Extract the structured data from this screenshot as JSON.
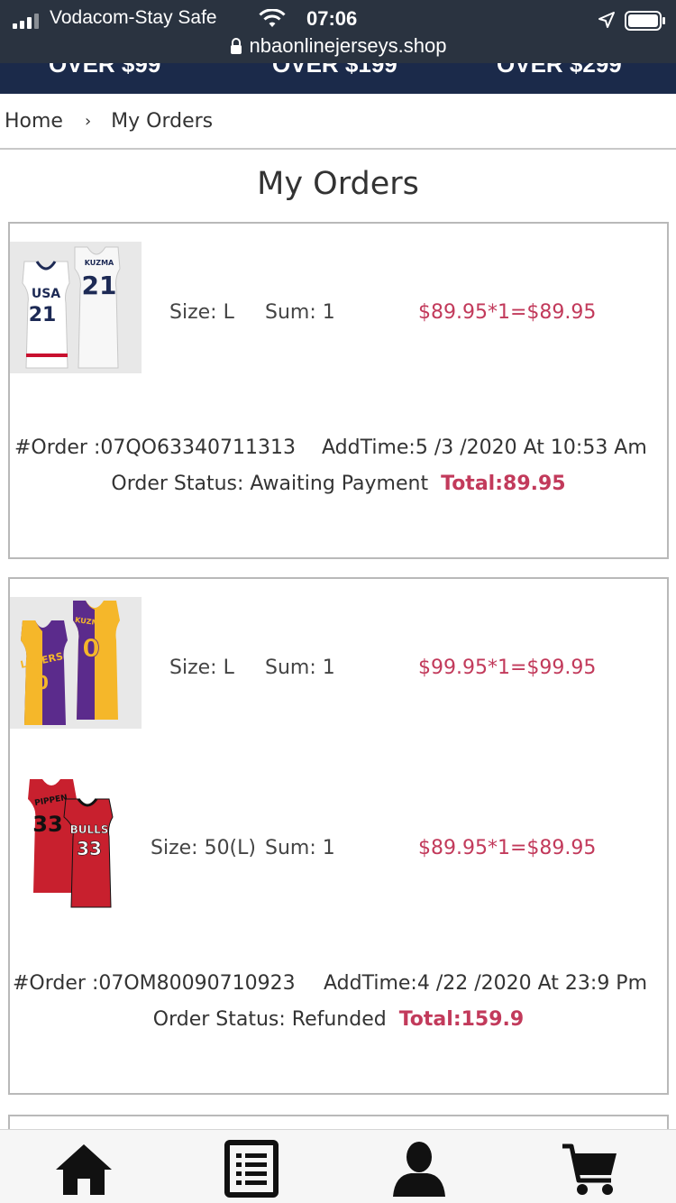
{
  "status_bar": {
    "carrier": "Vodacom-Stay Safe",
    "time": "07:06",
    "url": "nbaonlinejerseys.shop"
  },
  "banner_peek": {
    "items": [
      "OVER $99",
      "OVER $199",
      "OVER $299"
    ]
  },
  "breadcrumb": {
    "home": "Home",
    "separator": "›",
    "current": "My Orders"
  },
  "page_title": "My Orders",
  "orders": [
    {
      "items": [
        {
          "image": "usa-jersey-21-kuzma",
          "size": "Size: L",
          "sum": "Sum: 1",
          "price": "$89.95*1=$89.95"
        }
      ],
      "order_no": "#Order :07QO63340711313",
      "add_time": "AddTime:5 /3 /2020 At 10:53 Am",
      "status": "Order Status: Awaiting Payment",
      "total": "Total:89.95"
    },
    {
      "items": [
        {
          "image": "lakers-split-jersey-0-kuzma",
          "size": "Size: L",
          "sum": "Sum: 1",
          "price": "$99.95*1=$99.95"
        },
        {
          "image": "bulls-jersey-33-pippen",
          "size": "Size: 50(L)",
          "sum": "Sum: 1",
          "price": "$89.95*1=$89.95"
        }
      ],
      "order_no": "#Order :07OM80090710923",
      "add_time": "AddTime:4 /22 /2020 At 23:9 Pm",
      "status": "Order Status: Refunded",
      "total": "Total:159.9"
    }
  ],
  "tabbar": {
    "items": [
      "home-icon",
      "orders-list-icon",
      "account-icon",
      "cart-icon"
    ]
  },
  "colors": {
    "accent_price": "#c23a5b",
    "status_bar": "#2a3340",
    "banner": "#1b2a4a"
  }
}
